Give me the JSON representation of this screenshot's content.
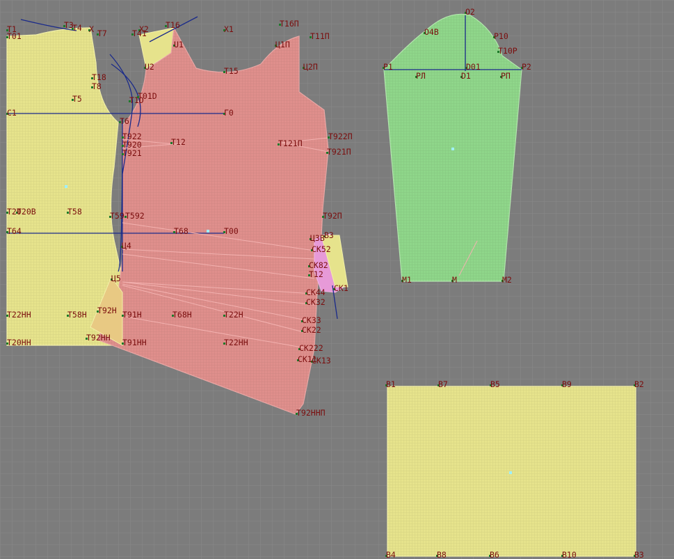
{
  "colors": {
    "background": "#7c7c7c",
    "grid": "#8a8a8a",
    "piece_yellow": "#e6e38c",
    "piece_pink": "#df8f8c",
    "piece_green": "#8fd68a",
    "dart_pink": "#e79ad8",
    "label": "#7a0d0d",
    "construction_line": "#1a2a8a",
    "marker": "#1d7a2a"
  },
  "labels": {
    "T1": "T1",
    "T01": "T01",
    "T3": "T3",
    "T4": "T4",
    "X": "X",
    "T7": "T7",
    "T18": "T18",
    "T8": "T8",
    "T5": "T5",
    "C1": "C1",
    "T6": "T6",
    "T20": "T20",
    "T20B": "T20B",
    "T58": "T58",
    "T59": "T59",
    "T592": "T592",
    "T64": "T64",
    "T68": "T68",
    "T6x00": "T00",
    "T22HH": "T22HH",
    "T58H": "T58H",
    "T92H": "T92H",
    "T91H": "T91H",
    "T68H": "T68H",
    "T22H": "T22H",
    "T20HH": "T20HH",
    "T92HH": "T92HH",
    "T91HH": "T91HH",
    "T22HH2": "T22HH",
    "X2": "X2",
    "T16": "T16",
    "T41": "T41",
    "X1": "X1",
    "U1": "U1",
    "U2": "U2",
    "T01D": "T01D",
    "T1D": "T1D",
    "T922": "T922",
    "T920": "T920",
    "T921": "T921",
    "T12": "T12",
    "T16P": "T16П",
    "T11P": "T11П",
    "U1P": "Ц1П",
    "U2P": "Ц2П",
    "T15": "T15",
    "G": "Г0",
    "T121P": "T121П",
    "T922P": "T922П",
    "T921P": "T921П",
    "T92P": "T92П",
    "U4": "Ц4",
    "U5": "Ц5",
    "U3B": "Ц3B",
    "CK52": "CK52",
    "B3": "B3",
    "CK82": "CK82",
    "T12b": "T12",
    "CK44": "CK44",
    "CK32": "CK32",
    "CK1": "CK1",
    "CK33": "CK33",
    "CK22": "CK22",
    "CK222": "CK222",
    "CK11": "CK11",
    "CK13": "CK13",
    "T92HHP": "T92ННП",
    "O2": "O2",
    "OdB": "O4B",
    "P0": "P10",
    "T10P": "T10P",
    "P1": "P1",
    "PL": "PЛ",
    "D1": "D1",
    "D0": "D01",
    "PP": "PП",
    "P2": "P2",
    "M1": "M1",
    "M": "M",
    "M2": "M2",
    "B1": "B1",
    "B7": "B7",
    "B5": "B5",
    "B9": "B9",
    "B2": "B2",
    "B4": "B4",
    "B8": "B8",
    "B6": "B6",
    "B10": "B10",
    "B3r": "B3"
  }
}
